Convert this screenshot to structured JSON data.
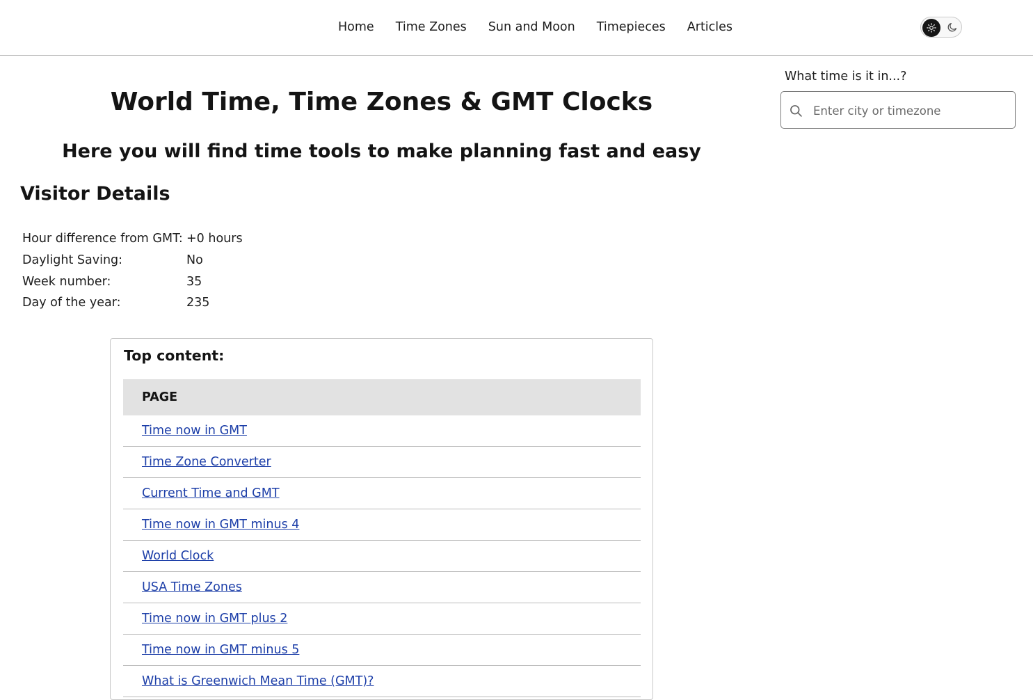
{
  "nav": {
    "items": [
      {
        "label": "Home"
      },
      {
        "label": "Time Zones"
      },
      {
        "label": "Sun and Moon"
      },
      {
        "label": "Timepieces"
      },
      {
        "label": "Articles"
      }
    ]
  },
  "theme_toggle": {
    "active_icon": "sun-icon",
    "inactive_icon": "moon-icon"
  },
  "search": {
    "label": "What time is it in...?",
    "placeholder": "Enter city or timezone",
    "value": ""
  },
  "main": {
    "title": "World Time, Time Zones & GMT Clocks",
    "subtitle": "Here you will find time tools to make planning fast and easy"
  },
  "visitor": {
    "title": "Visitor Details",
    "rows": [
      {
        "label": "Hour difference from GMT:",
        "value": "+0 hours"
      },
      {
        "label": "Daylight Saving:",
        "value": "No"
      },
      {
        "label": "Week number:",
        "value": "35"
      },
      {
        "label": "Day of the year:",
        "value": "235"
      }
    ]
  },
  "top_content": {
    "title": "Top content:",
    "column_header": "PAGE",
    "links": [
      "Time now in GMT",
      "Time Zone Converter",
      "Current Time and GMT",
      "Time now in GMT minus 4",
      "World Clock",
      "USA Time Zones",
      "Time now in GMT plus 2",
      "Time now in GMT minus 5",
      "What is Greenwich Mean Time (GMT)?"
    ]
  },
  "colors": {
    "link": "#1c3ea8",
    "header_bg": "#e2e2e2",
    "toggle_knob": "#161616"
  }
}
